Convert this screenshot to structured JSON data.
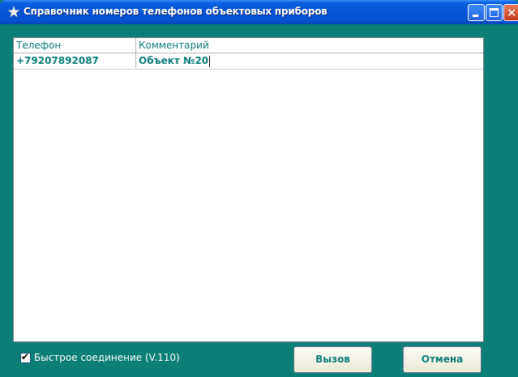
{
  "window": {
    "title": "Справочник номеров телефонов объектовых приборов",
    "icon": "star-icon"
  },
  "grid": {
    "columns": [
      "Телефон",
      "Комментарий"
    ],
    "rows": [
      {
        "phone": "+79207892087",
        "comment": "Объект №20"
      }
    ]
  },
  "options": {
    "fast_connection_label": "Быстрое соединение (V.110)",
    "fast_connection_checked": true
  },
  "buttons": {
    "call_label": "Вызов",
    "cancel_label": "Отмена"
  },
  "colors": {
    "background": "#0c7e78",
    "titlebar": "#0653d6",
    "text_accent": "#0c7e78"
  }
}
